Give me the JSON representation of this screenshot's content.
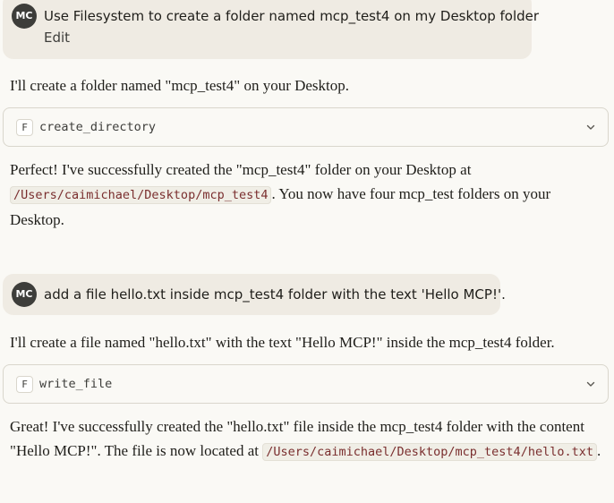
{
  "conversation": {
    "user_avatar_initials": "MC",
    "messages": [
      {
        "role": "user",
        "text": "Use Filesystem to create a folder named mcp_test4 on my Desktop folder",
        "action_label": "Edit"
      },
      {
        "role": "assistant",
        "intro": "I'll create a folder named \"mcp_test4\" on your Desktop.",
        "tool": {
          "server_badge": "F",
          "name": "create_directory"
        },
        "result_before": "Perfect! I've successfully created the \"mcp_test4\" folder on your Desktop at ",
        "result_path": "/Users/caimichael/Desktop/mcp_test4",
        "result_after": ". You now have four mcp_test folders on your Desktop."
      },
      {
        "role": "user",
        "text": "add a file hello.txt inside mcp_test4 folder with the text 'Hello MCP!'."
      },
      {
        "role": "assistant",
        "intro": "I'll create a file named \"hello.txt\" with the text \"Hello MCP!\" inside the mcp_test4 folder.",
        "tool": {
          "server_badge": "F",
          "name": "write_file"
        },
        "result_before": "Great! I've successfully created the \"hello.txt\" file inside the mcp_test4 folder with the content \"Hello MCP!\". The file is now located at ",
        "result_path": "/Users/caimichael/Desktop/mcp_test4/hello.txt",
        "result_after": "."
      }
    ]
  }
}
